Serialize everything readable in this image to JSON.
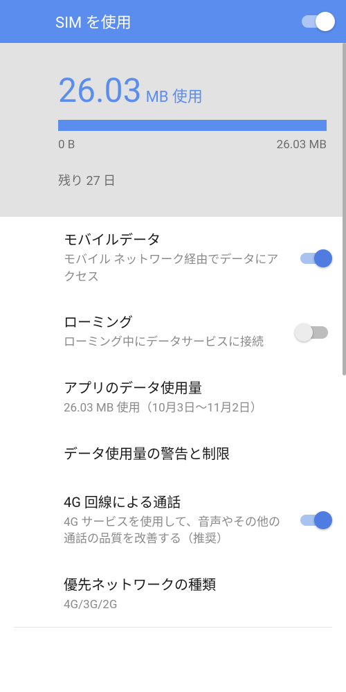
{
  "header": {
    "title": "SIM を使用",
    "toggle_on": true
  },
  "usage": {
    "amount": "26.03",
    "unit": "MB 使用",
    "range_start": "0 B",
    "range_end": "26.03 MB",
    "remaining": "残り 27 日"
  },
  "items": {
    "mobile_data": {
      "title": "モバイルデータ",
      "sub": "モバイル ネットワーク経由でデータにアクセス",
      "on": true
    },
    "roaming": {
      "title": "ローミング",
      "sub": "ローミング中にデータサービスに接続",
      "on": false
    },
    "app_usage": {
      "title": "アプリのデータ使用量",
      "sub": "26.03 MB 使用（10月3日～11月2日）"
    },
    "warning_limit": {
      "title": "データ使用量の警告と制限"
    },
    "calls_4g": {
      "title": "4G 回線による通話",
      "sub": "4G サービスを使用して、音声やその他の通話の品質を改善する（推奨）",
      "on": true
    },
    "network_type": {
      "title": "優先ネットワークの種類",
      "sub": "4G/3G/2G"
    }
  }
}
